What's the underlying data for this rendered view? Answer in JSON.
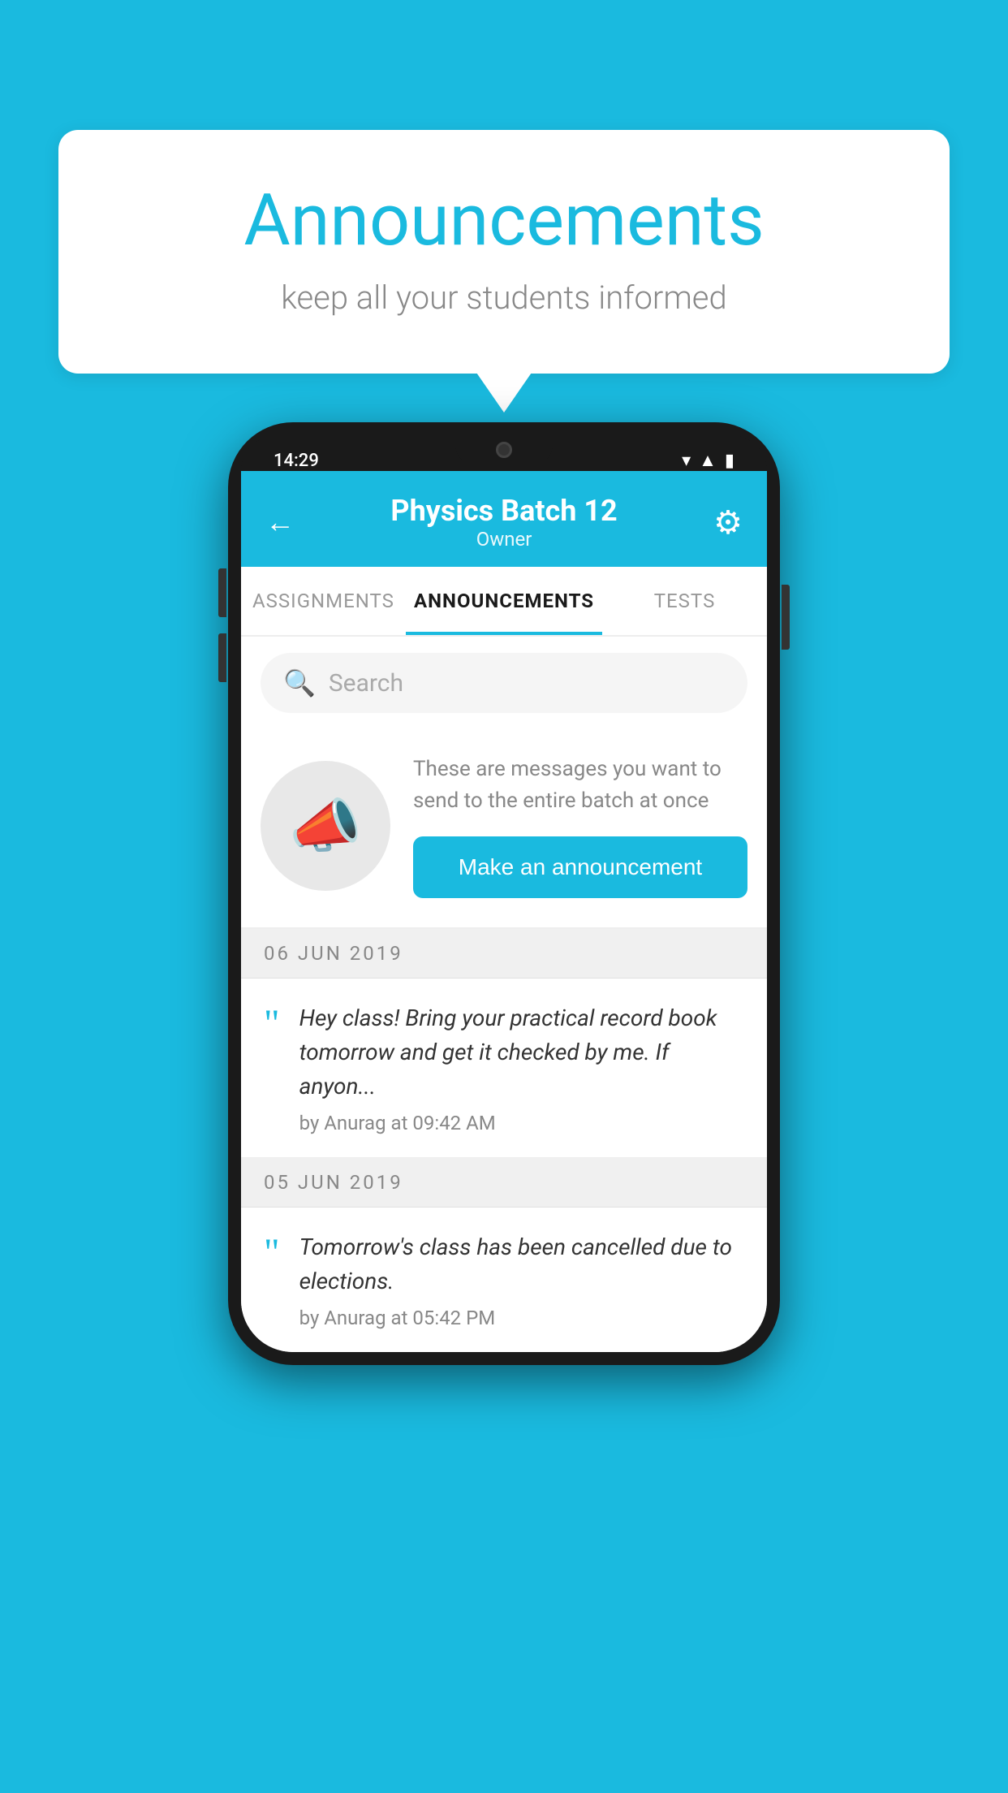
{
  "background": {
    "color": "#1ABADF"
  },
  "speech_bubble": {
    "title": "Announcements",
    "subtitle": "keep all your students informed"
  },
  "phone": {
    "status_bar": {
      "time": "14:29"
    },
    "header": {
      "back_label": "←",
      "title": "Physics Batch 12",
      "subtitle": "Owner",
      "settings_label": "⚙"
    },
    "tabs": [
      {
        "label": "ASSIGNMENTS",
        "active": false
      },
      {
        "label": "ANNOUNCEMENTS",
        "active": true
      },
      {
        "label": "TESTS",
        "active": false
      }
    ],
    "search": {
      "placeholder": "Search"
    },
    "promo": {
      "description": "These are messages you want to send to the entire batch at once",
      "button_label": "Make an announcement"
    },
    "announcements": [
      {
        "date": "06  JUN  2019",
        "text": "Hey class! Bring your practical record book tomorrow and get it checked by me. If anyon...",
        "meta": "by Anurag at 09:42 AM"
      },
      {
        "date": "05  JUN  2019",
        "text": "Tomorrow's class has been cancelled due to elections.",
        "meta": "by Anurag at 05:42 PM"
      }
    ]
  }
}
